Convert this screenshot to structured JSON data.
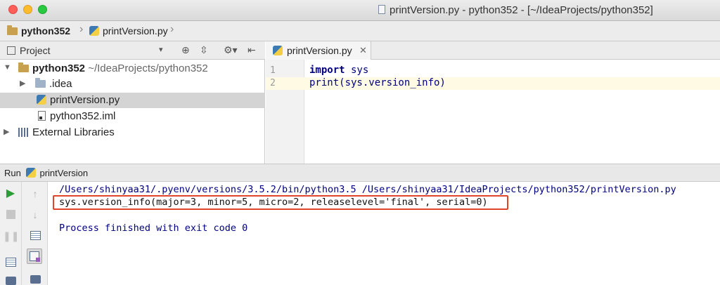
{
  "window": {
    "title": "printVersion.py - python352 - [~/IdeaProjects/python352]"
  },
  "navbar": {
    "crumbs": [
      "python352",
      "printVersion.py"
    ]
  },
  "project_pane": {
    "title": "Project",
    "dropdown": "▾",
    "tree": [
      {
        "label": "python352",
        "path": "~/IdeaProjects/python352",
        "icon": "project-folder-icon"
      },
      {
        "label": ".idea",
        "icon": "folder-icon"
      },
      {
        "label": "printVersion.py",
        "icon": "python-file-icon"
      },
      {
        "label": "python352.iml",
        "icon": "iml-file-icon"
      },
      {
        "label": "External Libraries",
        "icon": "library-icon"
      }
    ]
  },
  "editor": {
    "tab_label": "printVersion.py",
    "lines": [
      {
        "num": "1",
        "keyword": "import",
        "rest": " sys"
      },
      {
        "num": "2",
        "keyword": "",
        "rest": "print(sys.version_info)"
      }
    ]
  },
  "run": {
    "label": "Run",
    "config": "printVersion",
    "console": [
      "/Users/shinyaa31/.pyenv/versions/3.5.2/bin/python3.5 /Users/shinyaa31/IdeaProjects/python352/printVersion.py",
      "sys.version_info(major=3, minor=5, micro=2, releaselevel='final', serial=0)",
      "",
      "Process finished with exit code 0"
    ]
  },
  "colors": {
    "console_blue": "#000080",
    "highlight_border": "#e0452b",
    "current_line": "#fffae3",
    "selection": "#d4d4d4"
  }
}
